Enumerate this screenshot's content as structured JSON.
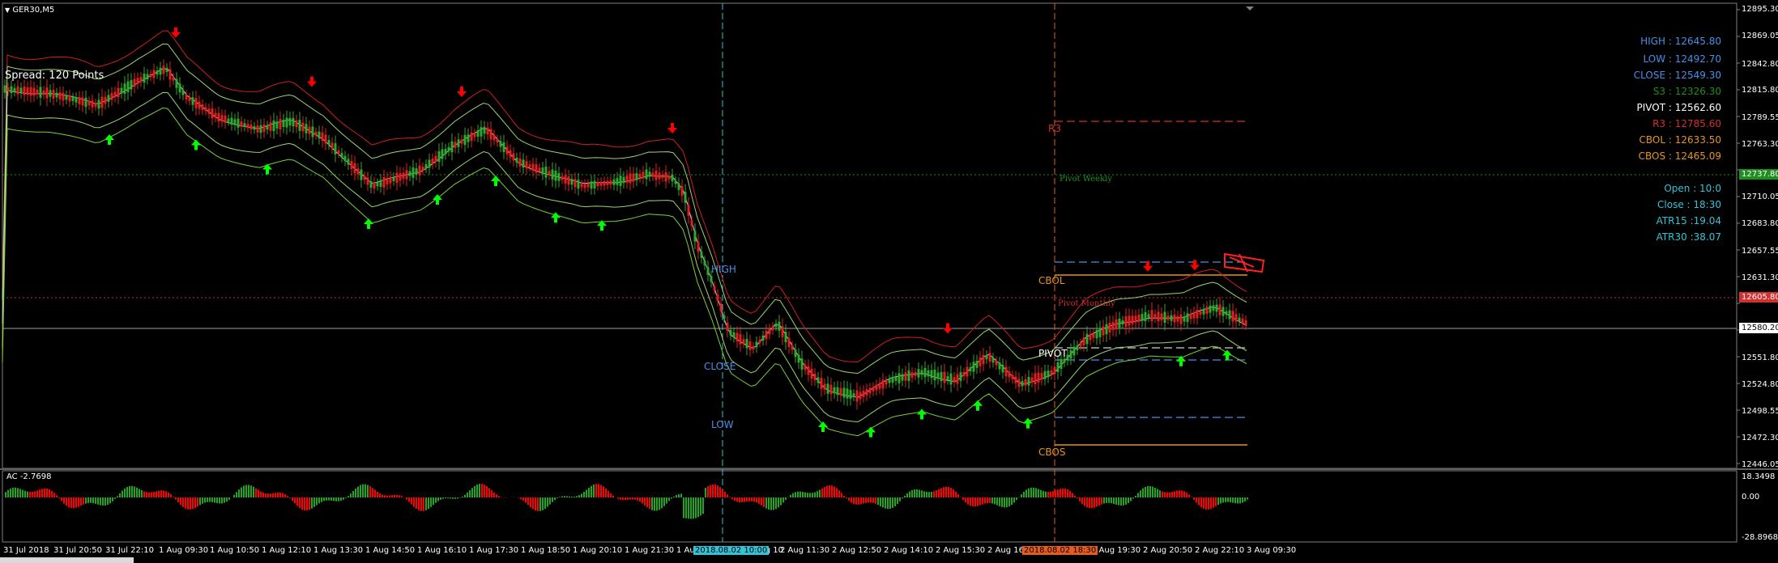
{
  "window": {
    "symbol_label": "GER30,M5",
    "spread_text": "Spread: 120 Points"
  },
  "colors": {
    "background": "#000000",
    "up_arrow": "#00ff00",
    "down_arrow": "#ff0000",
    "high_blue": "#4a8fe7",
    "low_blue": "#4a8fe7",
    "close_blue": "#4a8fe7",
    "s3_green": "#1e8f1e",
    "pivot_white": "#ffffff",
    "r3_red": "#d03030",
    "cbol_orange": "#e69420",
    "cbos_orange": "#e69420",
    "session_cyan": "#36c2d6",
    "ac_up": "#22a622",
    "ac_down": "#ff0000"
  },
  "info_panel": {
    "high": "HIGH : 12645.80",
    "low": "LOW : 12492.70",
    "close": "CLOSE : 12549.30",
    "s3": "S3 : 12326.30",
    "pivot": "PIVOT : 12562.60",
    "r3": "R3 : 12785.60",
    "cbol": "CBOL : 12633.50",
    "cbos": "CBOS : 12465.09",
    "open": "Open : 10:0",
    "close_time": "Close : 18:30",
    "atr15": "ATR15 :19.04",
    "atr30": "ATR30 :38.07"
  },
  "chart_labels": {
    "high": "HIGH",
    "close": "CLOSE",
    "low": "LOW",
    "r3": "R3",
    "pivot_weekly": "Pivot Weekly",
    "cbol": "CBOL",
    "pivot_monthly": "Pivot Monthly",
    "pivot": "PIVOT",
    "cbos": "CBOS"
  },
  "y_axis": {
    "labels": [
      "12895.30",
      "12869.05",
      "12842.80",
      "12815.80",
      "12789.55",
      "12763.30",
      "12710.05",
      "12683.80",
      "12657.55",
      "12631.30",
      "12551.80",
      "12524.80",
      "12498.55",
      "12472.30",
      "12446.05"
    ],
    "current_price": "12580.20",
    "weekly_price": "12737.80",
    "monthly_price": "12605.80"
  },
  "x_axis": {
    "labels": [
      "31 Jul 2018",
      "31 Jul 20:50",
      "31 Jul 22:10",
      "1 Aug 09:30",
      "1 Aug 10:50",
      "1 Aug 12:10",
      "1 Aug 13:30",
      "1 Aug 14:50",
      "1 Aug 16:10",
      "1 Aug 17:30",
      "1 Aug 18:50",
      "1 Aug 20:10",
      "1 Aug 21:30",
      "1 Aug 1",
      "2 Aug 10",
      "2 Aug 11:30",
      "2 Aug 12:50",
      "2 Aug 14:10",
      "2 Aug 15:30",
      "2 Aug 16:",
      "2 Aug 19:30",
      "2 Aug 20:50",
      "2 Aug 22:10",
      "3 Aug 09:30"
    ],
    "cursor_tag_1": "2018.08.02 10:00",
    "cursor_tag_2": "2018.08.02 18:30"
  },
  "indicator": {
    "name": "AC -2.7698",
    "y_labels": [
      "18.3498",
      "0.00",
      "-28.8968"
    ]
  }
}
